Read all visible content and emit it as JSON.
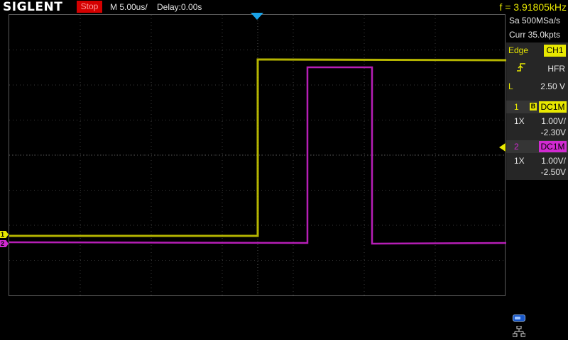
{
  "header": {
    "brand": "SIGLENT",
    "run_state": "Stop",
    "timebase": "M 5.00us/",
    "delay": "Delay:0.00s",
    "frequency": "f = 3.91805kHz"
  },
  "acquisition": {
    "sample_rate": "Sa 500MSa/s",
    "memory": "Curr 35.0kpts"
  },
  "trigger": {
    "type": "Edge",
    "source": "CH1",
    "slope_icon": "rising-edge-icon",
    "coupling": "HFR",
    "level_label": "L",
    "level": "2.50 V"
  },
  "channels": [
    {
      "number": "1",
      "bw_limit": "B",
      "coupling": "DC1M",
      "probe": "1X",
      "scale": "1.00V/",
      "offset": "-2.30V",
      "color": "#e8e800",
      "marker": "1"
    },
    {
      "number": "2",
      "coupling": "DC1M",
      "probe": "1X",
      "scale": "1.00V/",
      "offset": "-2.50V",
      "color": "#d12ad1",
      "marker": "2"
    }
  ],
  "status_icons": [
    "usb-icon",
    "lan-icon"
  ]
}
